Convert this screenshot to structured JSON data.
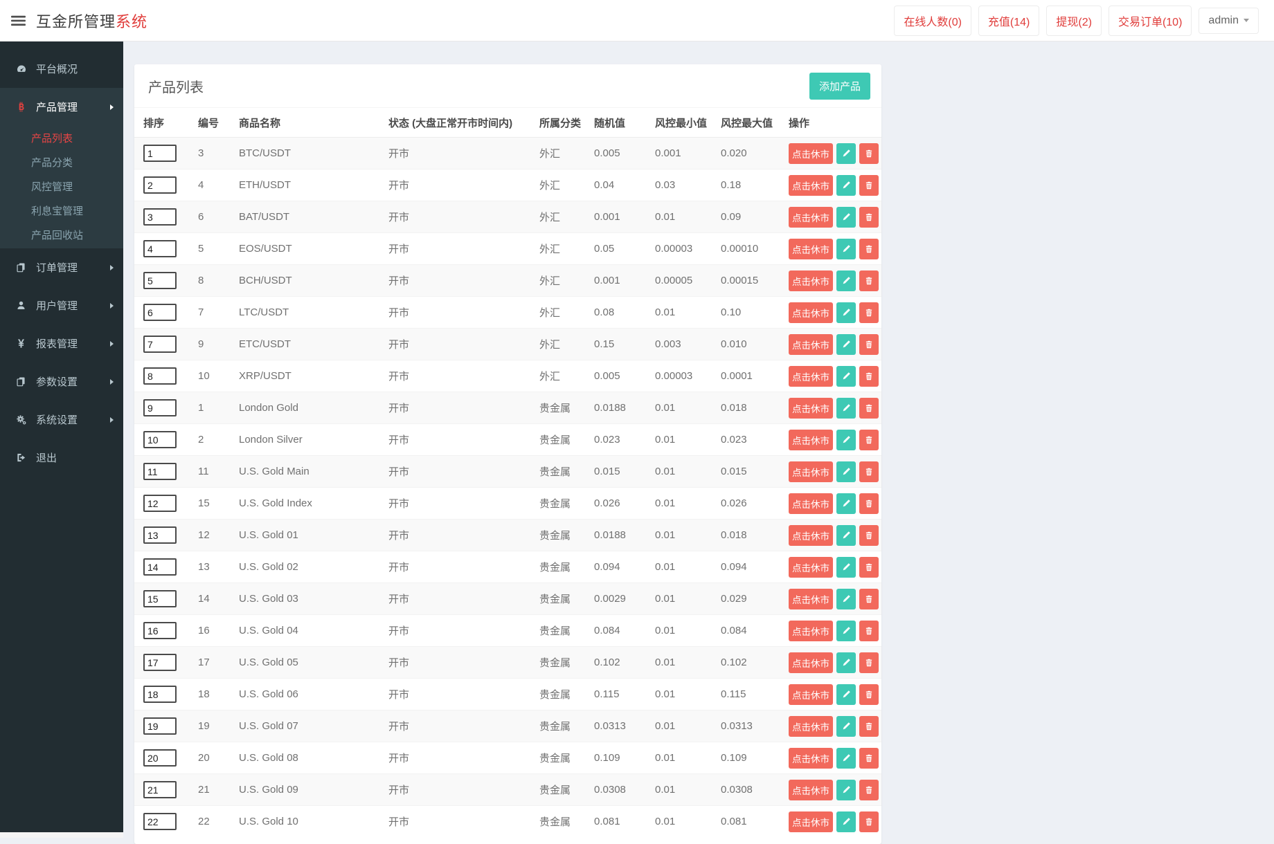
{
  "header": {
    "brand_primary": "互金所管理",
    "brand_accent": "系统",
    "nav_items": [
      {
        "label": "在线人数(0)"
      },
      {
        "label": "充值(14)"
      },
      {
        "label": "提现(2)"
      },
      {
        "label": "交易订单(10)"
      }
    ],
    "user": "admin"
  },
  "sidebar": {
    "items": [
      {
        "label": "平台概况",
        "icon": "dashboard-icon"
      },
      {
        "label": "产品管理",
        "icon": "bitcoin-icon",
        "active": true,
        "children": [
          "产品列表",
          "产品分类",
          "风控管理",
          "利息宝管理",
          "产品回收站"
        ],
        "active_child": "产品列表"
      },
      {
        "label": "订单管理",
        "icon": "files-icon"
      },
      {
        "label": "用户管理",
        "icon": "user-icon"
      },
      {
        "label": "报表管理",
        "icon": "yen-icon"
      },
      {
        "label": "参数设置",
        "icon": "files-icon"
      },
      {
        "label": "系统设置",
        "icon": "gears-icon"
      },
      {
        "label": "退出",
        "icon": "signout-icon"
      }
    ]
  },
  "page": {
    "title": "产品列表",
    "add_button": "添加产品"
  },
  "table": {
    "columns": [
      "排序",
      "编号",
      "商品名称",
      "状态 (大盘正常开市时间内)",
      "所属分类",
      "随机值",
      "风控最小值",
      "风控最大值",
      "操作"
    ],
    "actions": {
      "close_market_label": "点击休市",
      "edit_icon": "pencil-icon",
      "delete_icon": "trash-icon"
    },
    "rows": [
      {
        "sort": "1",
        "id": "3",
        "name": "BTC/USDT",
        "status": "开市",
        "category": "外汇",
        "random": "0.005",
        "risk_min": "0.001",
        "risk_max": "0.020"
      },
      {
        "sort": "2",
        "id": "4",
        "name": "ETH/USDT",
        "status": "开市",
        "category": "外汇",
        "random": "0.04",
        "risk_min": "0.03",
        "risk_max": "0.18"
      },
      {
        "sort": "3",
        "id": "6",
        "name": "BAT/USDT",
        "status": "开市",
        "category": "外汇",
        "random": "0.001",
        "risk_min": "0.01",
        "risk_max": "0.09"
      },
      {
        "sort": "4",
        "id": "5",
        "name": "EOS/USDT",
        "status": "开市",
        "category": "外汇",
        "random": "0.05",
        "risk_min": "0.00003",
        "risk_max": "0.00010"
      },
      {
        "sort": "5",
        "id": "8",
        "name": "BCH/USDT",
        "status": "开市",
        "category": "外汇",
        "random": "0.001",
        "risk_min": "0.00005",
        "risk_max": "0.00015"
      },
      {
        "sort": "6",
        "id": "7",
        "name": "LTC/USDT",
        "status": "开市",
        "category": "外汇",
        "random": "0.08",
        "risk_min": "0.01",
        "risk_max": "0.10"
      },
      {
        "sort": "7",
        "id": "9",
        "name": "ETC/USDT",
        "status": "开市",
        "category": "外汇",
        "random": "0.15",
        "risk_min": "0.003",
        "risk_max": "0.010"
      },
      {
        "sort": "8",
        "id": "10",
        "name": "XRP/USDT",
        "status": "开市",
        "category": "外汇",
        "random": "0.005",
        "risk_min": "0.00003",
        "risk_max": "0.0001"
      },
      {
        "sort": "9",
        "id": "1",
        "name": "London Gold",
        "status": "开市",
        "category": "贵金属",
        "random": "0.0188",
        "risk_min": "0.01",
        "risk_max": "0.018"
      },
      {
        "sort": "10",
        "id": "2",
        "name": "London Silver",
        "status": "开市",
        "category": "贵金属",
        "random": "0.023",
        "risk_min": "0.01",
        "risk_max": "0.023"
      },
      {
        "sort": "11",
        "id": "11",
        "name": "U.S. Gold Main",
        "status": "开市",
        "category": "贵金属",
        "random": "0.015",
        "risk_min": "0.01",
        "risk_max": "0.015"
      },
      {
        "sort": "12",
        "id": "15",
        "name": "U.S. Gold Index",
        "status": "开市",
        "category": "贵金属",
        "random": "0.026",
        "risk_min": "0.01",
        "risk_max": "0.026"
      },
      {
        "sort": "13",
        "id": "12",
        "name": "U.S. Gold 01",
        "status": "开市",
        "category": "贵金属",
        "random": "0.0188",
        "risk_min": "0.01",
        "risk_max": "0.018"
      },
      {
        "sort": "14",
        "id": "13",
        "name": "U.S. Gold 02",
        "status": "开市",
        "category": "贵金属",
        "random": "0.094",
        "risk_min": "0.01",
        "risk_max": "0.094"
      },
      {
        "sort": "15",
        "id": "14",
        "name": "U.S. Gold 03",
        "status": "开市",
        "category": "贵金属",
        "random": "0.0029",
        "risk_min": "0.01",
        "risk_max": "0.029"
      },
      {
        "sort": "16",
        "id": "16",
        "name": "U.S. Gold 04",
        "status": "开市",
        "category": "贵金属",
        "random": "0.084",
        "risk_min": "0.01",
        "risk_max": "0.084"
      },
      {
        "sort": "17",
        "id": "17",
        "name": "U.S. Gold 05",
        "status": "开市",
        "category": "贵金属",
        "random": "0.102",
        "risk_min": "0.01",
        "risk_max": "0.102"
      },
      {
        "sort": "18",
        "id": "18",
        "name": "U.S. Gold 06",
        "status": "开市",
        "category": "贵金属",
        "random": "0.115",
        "risk_min": "0.01",
        "risk_max": "0.115"
      },
      {
        "sort": "19",
        "id": "19",
        "name": "U.S. Gold 07",
        "status": "开市",
        "category": "贵金属",
        "random": "0.0313",
        "risk_min": "0.01",
        "risk_max": "0.0313"
      },
      {
        "sort": "20",
        "id": "20",
        "name": "U.S. Gold 08",
        "status": "开市",
        "category": "贵金属",
        "random": "0.109",
        "risk_min": "0.01",
        "risk_max": "0.109"
      },
      {
        "sort": "21",
        "id": "21",
        "name": "U.S. Gold 09",
        "status": "开市",
        "category": "贵金属",
        "random": "0.0308",
        "risk_min": "0.01",
        "risk_max": "0.0308"
      },
      {
        "sort": "22",
        "id": "22",
        "name": "U.S. Gold 10",
        "status": "开市",
        "category": "贵金属",
        "random": "0.081",
        "risk_min": "0.01",
        "risk_max": "0.081"
      }
    ]
  },
  "colors": {
    "accent_red": "#e03c3a",
    "teal": "#3ec9b4",
    "coral": "#f2695c",
    "sidebar_bg": "#222d32",
    "sidebar_submenu_bg": "#2c3b41",
    "page_bg": "#edf0f5"
  }
}
